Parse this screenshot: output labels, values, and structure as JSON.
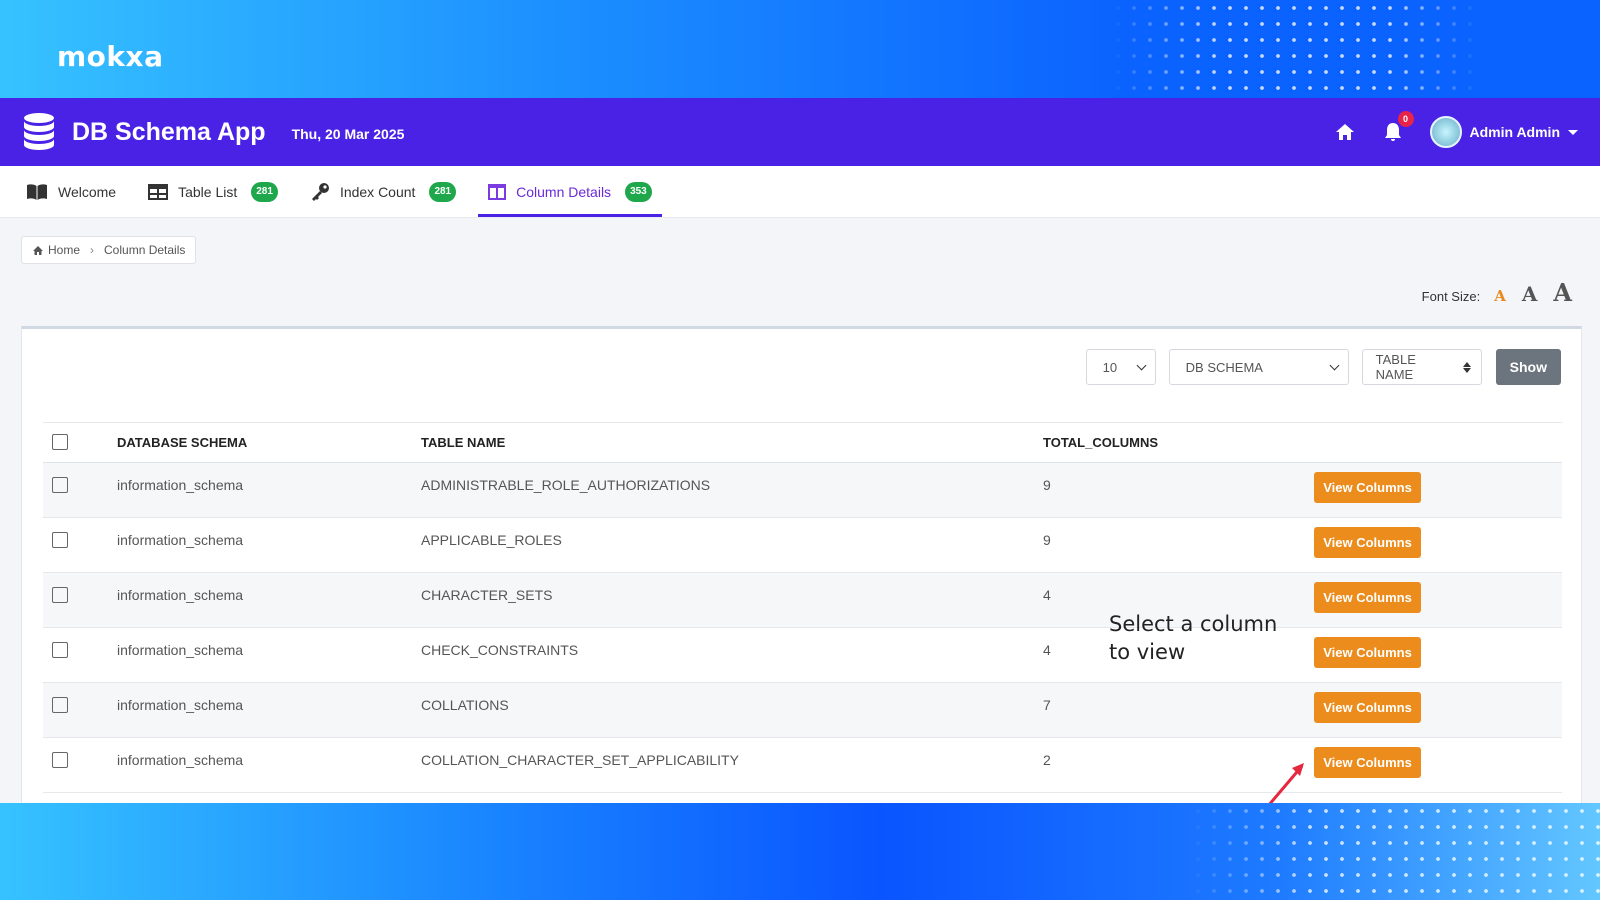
{
  "brand": "mokxa",
  "navbar": {
    "title": "DB Schema App",
    "date": "Thu, 20 Mar 2025",
    "notifications_count": "0",
    "user_name": "Admin Admin"
  },
  "tabs": [
    {
      "label": "Welcome",
      "icon": "book-icon"
    },
    {
      "label": "Table List",
      "icon": "table-icon",
      "count": "281"
    },
    {
      "label": "Index Count",
      "icon": "key-icon",
      "count": "281"
    },
    {
      "label": "Column Details",
      "icon": "columns-icon",
      "count": "353",
      "active": true
    }
  ],
  "breadcrumb": {
    "home": "Home",
    "current": "Column Details"
  },
  "font_size": {
    "label": "Font Size:",
    "options": [
      "A",
      "A",
      "A"
    ]
  },
  "controls": {
    "page_size": "10",
    "schema_select": "DB SCHEMA",
    "sort_select": "TABLE NAME",
    "show_label": "Show"
  },
  "table": {
    "headers": [
      "DATABASE SCHEMA",
      "TABLE NAME",
      "TOTAL_COLUMNS"
    ],
    "rows": [
      {
        "schema": "information_schema",
        "table": "ADMINISTRABLE_ROLE_AUTHORIZATIONS",
        "total": "9",
        "action": "View Columns"
      },
      {
        "schema": "information_schema",
        "table": "APPLICABLE_ROLES",
        "total": "9",
        "action": "View Columns"
      },
      {
        "schema": "information_schema",
        "table": "CHARACTER_SETS",
        "total": "4",
        "action": "View Columns"
      },
      {
        "schema": "information_schema",
        "table": "CHECK_CONSTRAINTS",
        "total": "4",
        "action": "View Columns"
      },
      {
        "schema": "information_schema",
        "table": "COLLATIONS",
        "total": "7",
        "action": "View Columns"
      },
      {
        "schema": "information_schema",
        "table": "COLLATION_CHARACTER_SET_APPLICABILITY",
        "total": "2",
        "action": "View Columns"
      }
    ]
  },
  "annotation": {
    "line1": "Select a column",
    "line2": "to view"
  },
  "colors": {
    "navbar": "#4a22e6",
    "accent_orange": "#ec8c1c",
    "badge_green": "#1ea84b",
    "arrow_red": "#e5283f"
  }
}
